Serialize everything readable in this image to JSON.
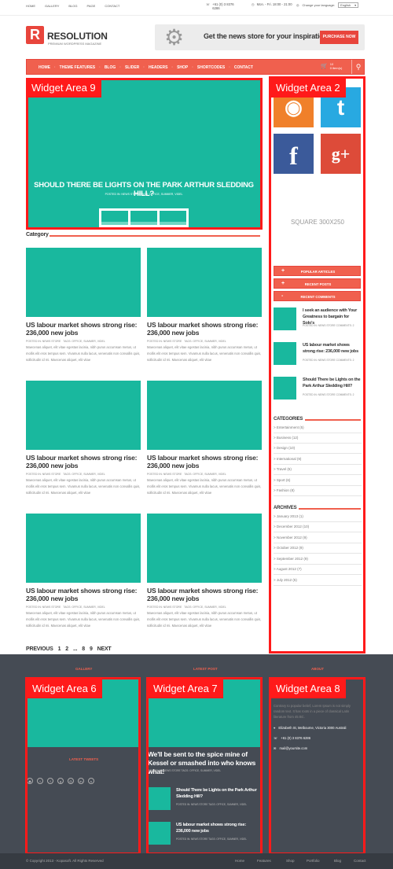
{
  "topbar": {
    "nav": [
      "HOME",
      "GALLERY",
      "BLOG",
      "PAGE",
      "CONTACT"
    ],
    "phone": "+61 (0) 3 8376 6286",
    "hours": "Mon. - Fri. 18:00 - 21:00",
    "lang_label": "Change your language:",
    "lang_value": "English"
  },
  "header": {
    "logo_letter": "R",
    "brand": "RESOLUTION",
    "tagline": "PREMIUM WORDPRESS MAGAZINE",
    "banner_text": "Get the news store for your inspiration!",
    "banner_button": "PURCHASE NOW"
  },
  "menu": {
    "items": [
      "HOME",
      "THEME FEATURES",
      "BLOG",
      "SLIDER",
      "HEADERS",
      "SHOP",
      "SHORTCODES",
      "CONTACT"
    ],
    "cart_count": "10",
    "cart_label": "0 item(s)"
  },
  "widgets": {
    "w9": "Widget Area 9",
    "w2": "Widget Area 2",
    "w6": "Widget Area 6",
    "w7": "Widget Area 7",
    "w8": "Widget Area 8"
  },
  "hero": {
    "title": "SHOULD THERE BE LIGHTS ON THE PARK ARTHUR SLEDDING HILL?",
    "meta": "POSTED IN: NEWS STORE      TAGS: OFFICE, SUMMER, VIDEL"
  },
  "category": {
    "heading": "Category",
    "cards": [
      {
        "title": "US labour market shows strong rise: 236,000 new jobs",
        "meta_left": "POSTED IN: NEWS STORE",
        "meta_right": "TAGS: OFFICE, SUMMER, VIDEL",
        "excerpt": "Maecenas aliquet, elit vitae egestas lacinia, nibh purus accumsan metus, ut mollis elit eros tempus sem. Vivamus nulla lacus, venenatis non convallis quis, sollicitudin id mi. Maecenas aliquet, elit vitae"
      },
      {
        "title": "US labour market shows strong rise: 236,000 new jobs",
        "meta_left": "POSTED IN: NEWS STORE",
        "meta_right": "TAGS: OFFICE, SUMMER, VIDEL",
        "excerpt": "Maecenas aliquet, elit vitae egestas lacinia, nibh purus accumsan metus, ut mollis elit eros tempus sem. Vivamus nulla lacus, venenatis non convallis quis, sollicitudin id mi. Maecenas aliquet, elit vitae"
      },
      {
        "title": "US labour market shows strong rise: 236,000 new jobs",
        "meta_left": "POSTED IN: NEWS STORE",
        "meta_right": "TAGS: OFFICE, SUMMER, VIDEL",
        "excerpt": "Maecenas aliquet, elit vitae egestas lacinia, nibh purus accumsan metus, ut mollis elit eros tempus sem. Vivamus nulla lacus, venenatis non convallis quis, sollicitudin id mi. Maecenas aliquet, elit vitae"
      },
      {
        "title": "US labour market shows strong rise: 236,000 new jobs",
        "meta_left": "POSTED IN: NEWS STORE",
        "meta_right": "TAGS: OFFICE, SUMMER, VIDEL",
        "excerpt": "Maecenas aliquet, elit vitae egestas lacinia, nibh purus accumsan metus, ut mollis elit eros tempus sem. Vivamus nulla lacus, venenatis non convallis quis, sollicitudin id mi. Maecenas aliquet, elit vitae"
      },
      {
        "title": "US labour market shows strong rise: 236,000 new jobs",
        "meta_left": "POSTED IN: NEWS STORE",
        "meta_right": "TAGS: OFFICE, SUMMER, VIDEL",
        "excerpt": "Maecenas aliquet, elit vitae egestas lacinia, nibh purus accumsan metus, ut mollis elit eros tempus sem. Vivamus nulla lacus, venenatis non convallis quis, sollicitudin id mi. Maecenas aliquet, elit vitae"
      },
      {
        "title": "US labour market shows strong rise: 236,000 new jobs",
        "meta_left": "POSTED IN: NEWS STORE",
        "meta_right": "TAGS: OFFICE, SUMMER, VIDEL",
        "excerpt": "Maecenas aliquet, elit vitae egestas lacinia, nibh purus accumsan metus, ut mollis elit eros tempus sem. Vivamus nulla lacus, venenatis non convallis quis, sollicitudin id mi. Maecenas aliquet, elit vitae"
      }
    ]
  },
  "pager": {
    "prev": "PREVIOUS",
    "p1": "1",
    "p2": "2",
    "dots": "...",
    "p8": "8",
    "p9": "9",
    "next": "NEXT"
  },
  "sidebar": {
    "social": [
      {
        "icon": "rss-icon",
        "glyph": "◉",
        "color": "#f0802a"
      },
      {
        "icon": "twitter-icon",
        "glyph": "t",
        "color": "#28a9e1"
      },
      {
        "icon": "facebook-icon",
        "glyph": "f",
        "color": "#3b5a9a"
      },
      {
        "icon": "googleplus-icon",
        "glyph": "g+",
        "color": "#dd4b39"
      }
    ],
    "square": "SQUARE 300X250",
    "accordion": [
      "POPULAR ARTICLES",
      "RECENT POSTS",
      "RECENT COMMENTS"
    ],
    "accordion_signs": [
      "+",
      "+",
      "-"
    ],
    "posts": [
      {
        "title": "I seek an audience with Your Greatness to bargain for Solo's",
        "meta": "POSTED IN: NEWS STORE      COMMENTS: 2"
      },
      {
        "title": "US labour market shows strong rise: 236,000 new jobs",
        "meta": "POSTED IN: NEWS STORE      COMMENTS: 2"
      },
      {
        "title": "Should There be Lights on the Park Arthur Sledding Hill?",
        "meta": "POSTED IN: NEWS STORE      COMMENTS: 2"
      }
    ],
    "categories_title": "CATEGORIES",
    "categories": [
      "Entertainment (5)",
      "Business (12)",
      "Design (10)",
      "International (9)",
      "Travel (5)",
      "Sport (6)",
      "Fashion (8)"
    ],
    "archives_title": "ARCHIVES",
    "archives": [
      "January 2013 (1)",
      "December 2012 (10)",
      "November 2012 (9)",
      "October 2012 (9)",
      "September 2012 (9)",
      "August 2012 (7)",
      "July 2012 (5)"
    ]
  },
  "footer": {
    "gallery": "GALLERY",
    "latest_post": "LATEST POST",
    "about": "ABOUT",
    "latest_tweets": "LATEST TWEETS",
    "feature_title": "We'll be sent to the spice mine of Kessel or smashed into who knows what!",
    "feature_meta": "POSTED IN: NEWS STORE      TAGS: OFFICE, SUMMER, VIDEL",
    "posts": [
      {
        "title": "Should There be Lights on the Park Arthur Sledding Hill?",
        "meta": "POSTED IN: NEWS STORE      TAGS: OFFICE, SUMMER, VIDEL"
      },
      {
        "title": "US labour market shows strong rise: 236,000 new jobs",
        "meta": "POSTED IN: NEWS STORE      TAGS: OFFICE, SUMMER, VIDEL"
      }
    ],
    "about_text": "Contrary to popular belief, Lorem Ipsum is not simply random text. It has roots in a piece of classical Latin literature from 45 BC.",
    "address": "Elizabeth St, Melbourne, Victoria 3000 Australi",
    "phone": "+61 (0) 3 8376 6286",
    "email": "mail@yoursite.com",
    "copyright": "© Copyright 2013 - Kopasoft. All Rights Reserved",
    "links": [
      "Home",
      "Features",
      "Shop",
      "Portfolio",
      "Blog",
      "Contact"
    ]
  }
}
